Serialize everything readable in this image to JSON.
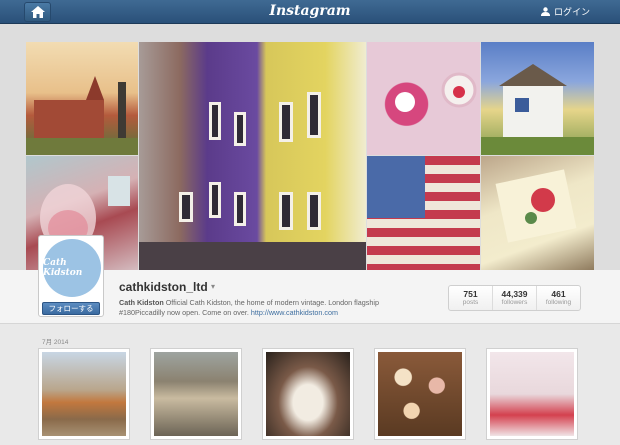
{
  "topbar": {
    "logo": "Instagram",
    "login_label": "ログイン",
    "home_icon": "home-icon",
    "user_icon": "user-icon",
    "background": "#2f5780"
  },
  "profile": {
    "avatar_text": "Cath Kidston",
    "follow_label": "フォローする",
    "username": "cathkidston_ltd",
    "bio_name": "Cath Kidston",
    "bio_text": " Official Cath Kidston, the home of modern vintage. London flagship #180Piccadilly now open. Come on over. ",
    "bio_link": "http://www.cathkidston.com",
    "link_color": "#3f6fa0"
  },
  "stats": [
    {
      "value": "751",
      "label": "posts"
    },
    {
      "value": "44,339",
      "label": "followers"
    },
    {
      "value": "461",
      "label": "following"
    }
  ],
  "gallery": {
    "date_label": "7月 2014"
  }
}
